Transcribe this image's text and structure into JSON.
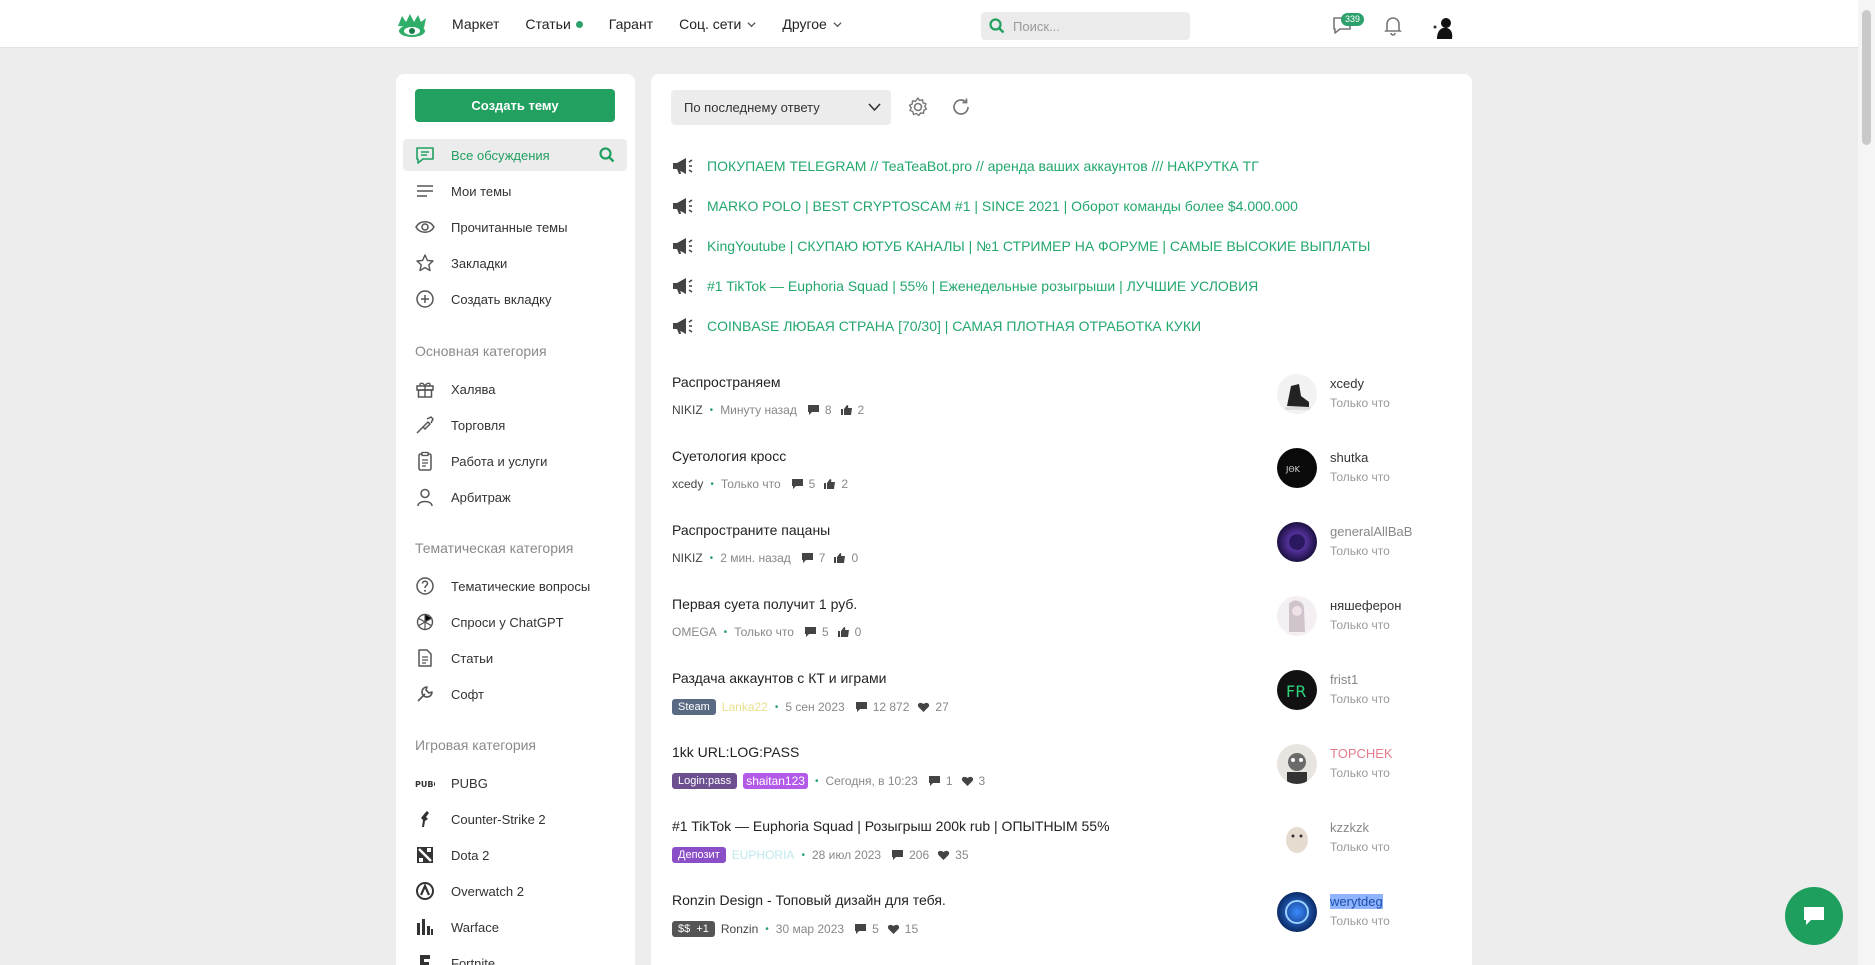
{
  "topbar": {
    "nav": [
      {
        "label": "Маркет",
        "dot": false,
        "chevron": false
      },
      {
        "label": "Статьи",
        "dot": true,
        "chevron": false
      },
      {
        "label": "Гарант",
        "dot": false,
        "chevron": false
      },
      {
        "label": "Соц. сети",
        "dot": false,
        "chevron": true
      },
      {
        "label": "Другое",
        "dot": false,
        "chevron": true
      }
    ],
    "search_placeholder": "Поиск...",
    "messages_badge": "339"
  },
  "sidebar": {
    "create_button": "Создать тему",
    "main_items": [
      {
        "label": "Все обсуждения",
        "icon": "chat-icon",
        "active": true
      },
      {
        "label": "Мои темы",
        "icon": "list-icon",
        "active": false
      },
      {
        "label": "Прочитанные темы",
        "icon": "eye-icon",
        "active": false
      },
      {
        "label": "Закладки",
        "icon": "star-icon",
        "active": false
      },
      {
        "label": "Создать вкладку",
        "icon": "plus-circle-icon",
        "active": false
      }
    ],
    "sections": [
      {
        "title": "Основная категория",
        "items": [
          {
            "label": "Халява",
            "icon": "gift-icon"
          },
          {
            "label": "Торговля",
            "icon": "handshake-icon"
          },
          {
            "label": "Работа и услуги",
            "icon": "clipboard-icon"
          },
          {
            "label": "Арбитраж",
            "icon": "person-icon"
          }
        ]
      },
      {
        "title": "Тематическая категория",
        "items": [
          {
            "label": "Тематические вопросы",
            "icon": "question-icon"
          },
          {
            "label": "Спроси у ChatGPT",
            "icon": "openai-icon"
          },
          {
            "label": "Статьи",
            "icon": "document-icon"
          },
          {
            "label": "Софт",
            "icon": "wrench-icon"
          }
        ]
      },
      {
        "title": "Игровая категория",
        "items": [
          {
            "label": "PUBG",
            "icon": "pubg-icon"
          },
          {
            "label": "Counter-Strike 2",
            "icon": "cs-icon"
          },
          {
            "label": "Dota 2",
            "icon": "dota-icon"
          },
          {
            "label": "Overwatch 2",
            "icon": "overwatch-icon"
          },
          {
            "label": "Warface",
            "icon": "warface-icon"
          },
          {
            "label": "Fortnite",
            "icon": "fortnite-icon"
          }
        ]
      }
    ]
  },
  "main": {
    "sort_label": "По последнему ответу",
    "pinned": [
      "ПОКУПАЕМ TELEGRAM // TeaTeaBot.pro // аренда ваших аккаунтов /// НАКРУТКА ТГ",
      "MARKO POLO | BEST CRYPTOSCAM #1 | SINCE 2021 | Оборот команды более $4.000.000",
      "KingYoutube | СКУПАЮ ЮТУБ КАНАЛЫ | №1 СТРИМЕР НА ФОРУМЕ | САМЫЕ ВЫСОКИЕ ВЫПЛАТЫ",
      "#1 TikTok — Euphoria Squad | 55% | Еженедельные розыгрыши | ЛУЧШИЕ УСЛОВИЯ",
      "COINBASE ЛЮБАЯ СТРАНА [70/30] | САМАЯ ПЛОТНАЯ ОТРАБОТКА КУКИ"
    ],
    "threads": [
      {
        "title": "Распространяем",
        "tag": "",
        "author": "NIKIZ",
        "time": "Минуту назад",
        "replies": "8",
        "reaction": "2",
        "reaction_type": "like",
        "last_user": "xcedy",
        "last_time": "Только что"
      },
      {
        "title": "Суетология кросс",
        "tag": "",
        "author": "xcedy",
        "time": "Только что",
        "replies": "5",
        "reaction": "2",
        "reaction_type": "like",
        "last_user": "shutka",
        "last_time": "Только что"
      },
      {
        "title": "Распространите пацаны",
        "tag": "",
        "author": "NIKIZ",
        "time": "2 мин. назад",
        "replies": "7",
        "reaction": "0",
        "reaction_type": "like",
        "last_user": "generalAllBaB",
        "last_time": "Только что"
      },
      {
        "title": "Первая суета получит 1 руб.",
        "tag": "",
        "author": "OMEGA",
        "time": "Только что",
        "replies": "5",
        "reaction": "0",
        "reaction_type": "like",
        "last_user": "няшеферон",
        "last_time": "Только что"
      },
      {
        "title": "Раздача аккаунтов с КТ и играми",
        "tag": "Steam",
        "author": "Lanka22",
        "time": "5 сен 2023",
        "replies": "12 872",
        "reaction": "27",
        "reaction_type": "heart",
        "last_user": "frist1",
        "last_time": "Только что"
      },
      {
        "title": "1kk URL:LOG:PASS",
        "tag": "Login:pass",
        "author": "shaitan123",
        "time": "Сегодня, в 10:23",
        "replies": "1",
        "reaction": "3",
        "reaction_type": "heart",
        "last_user": "TOPCHEK",
        "last_time": "Только что"
      },
      {
        "title": "#1 TikTok — Euphoria Squad | Розыгрыш 200k rub | ОПЫТНЫМ 55%",
        "tag": "Депозит",
        "author": "EUPHORIA",
        "time": "28 июл 2023",
        "replies": "206",
        "reaction": "35",
        "reaction_type": "heart",
        "last_user": "kzzkzk",
        "last_time": "Только что"
      },
      {
        "title": "Ronzin Design - Топовый дизайн для тебя.",
        "tag": "$$  +1",
        "author": "Ronzin",
        "time": "30 мар 2023",
        "replies": "5",
        "reaction": "15",
        "reaction_type": "heart",
        "last_user": "werytdeg",
        "last_time": "Только что"
      }
    ]
  },
  "colors": {
    "accent": "#21a060",
    "pinned_link": "#23a76d",
    "background": "#ededed"
  }
}
